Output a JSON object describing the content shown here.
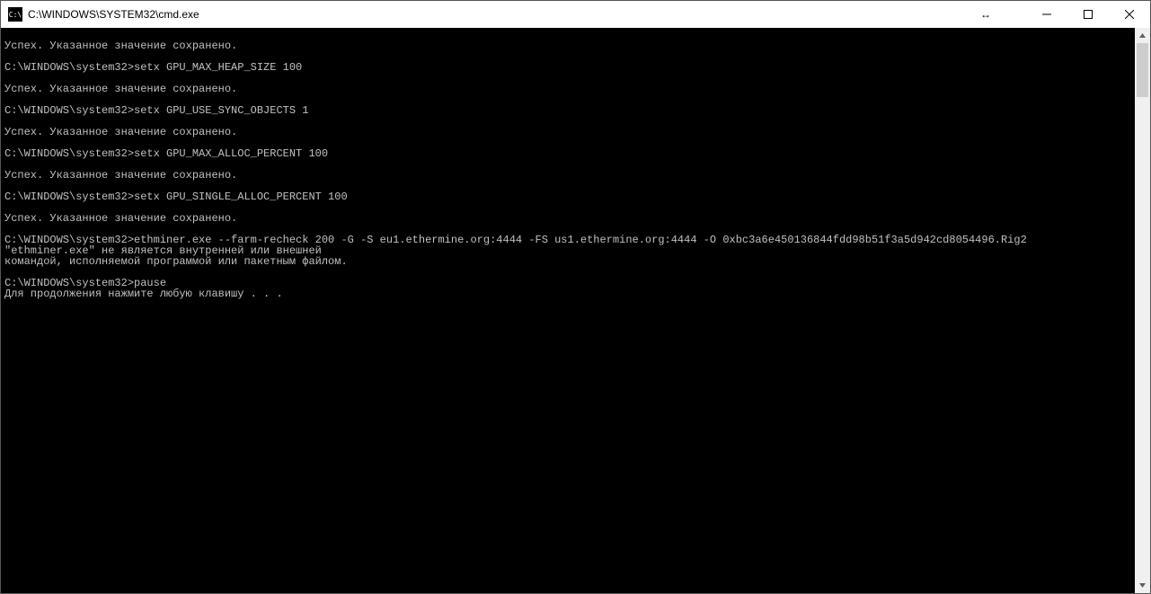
{
  "title": "C:\\WINDOWS\\SYSTEM32\\cmd.exe",
  "icon_text": "C:\\",
  "terminal_lines": [
    "",
    "Успех. Указанное значение сохранено.",
    "",
    "C:\\WINDOWS\\system32>setx GPU_MAX_HEAP_SIZE 100",
    "",
    "Успех. Указанное значение сохранено.",
    "",
    "C:\\WINDOWS\\system32>setx GPU_USE_SYNC_OBJECTS 1",
    "",
    "Успех. Указанное значение сохранено.",
    "",
    "C:\\WINDOWS\\system32>setx GPU_MAX_ALLOC_PERCENT 100",
    "",
    "Успех. Указанное значение сохранено.",
    "",
    "C:\\WINDOWS\\system32>setx GPU_SINGLE_ALLOC_PERCENT 100",
    "",
    "Успех. Указанное значение сохранено.",
    "",
    "C:\\WINDOWS\\system32>ethminer.exe --farm-recheck 200 -G -S eu1.ethermine.org:4444 -FS us1.ethermine.org:4444 -O 0xbc3a6e450136844fdd98b51f3a5d942cd8054496.Rig2",
    "\"ethminer.exe\" не является внутренней или внешней",
    "командой, исполняемой программой или пакетным файлом.",
    "",
    "C:\\WINDOWS\\system32>pause",
    "Для продолжения нажмите любую клавишу . . ."
  ]
}
